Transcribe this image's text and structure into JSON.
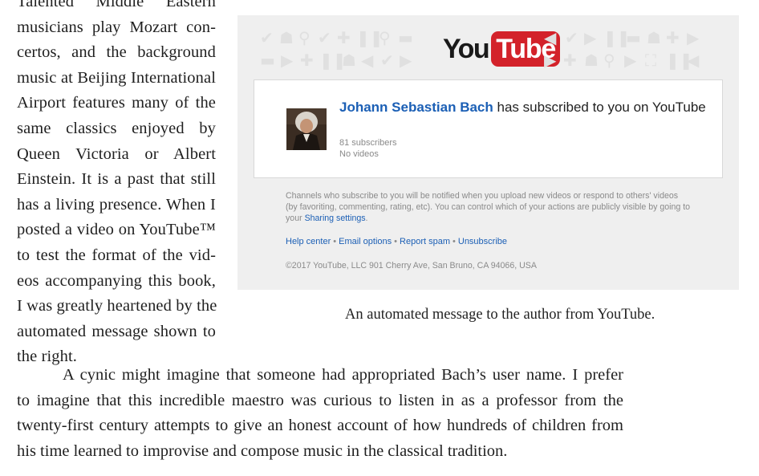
{
  "left_column": {
    "lines": [
      "Talented Middle Eastern",
      "musicians play Mozart con-",
      "certos, and the background",
      "music at Beijing International",
      "Airport features many of the",
      "same classics enjoyed by",
      "Queen Victoria or Albert",
      "Einstein. It is a past that still",
      "has a living presence. When I",
      "posted a video on YouTube™",
      "to test the format of the vid-",
      "eos accompanying this book,",
      "I was greatly heartened by the",
      "automated message shown to",
      "the right."
    ]
  },
  "figure": {
    "logo_you": "You",
    "logo_tube": "Tube",
    "notification": {
      "channel_name": "Johann Sebastian Bach",
      "message": " has subscribed to you on YouTube",
      "subscribers": "81 subscribers",
      "videos": "No videos",
      "avatar_icon": "portrait-icon"
    },
    "footnote_text": "Channels who subscribe to you will be notified when you upload new videos or respond to others' videos (by favoriting, commenting, rating, etc). You can control which of your actions are publicly visible by going to your ",
    "footnote_link": "Sharing settings",
    "footnote_end": ".",
    "links": [
      "Help center",
      "Email options",
      "Report spam",
      "Unsubscribe"
    ],
    "copyright": "©2017 YouTube, LLC 901 Cherry Ave, San Bruno, CA 94066, USA",
    "colors": {
      "link_blue": "#1b5fb5",
      "youtube_red": "#d3222a",
      "background": "#efefef"
    }
  },
  "caption": "An automated message to the author from YouTube.",
  "bottom_paragraph": {
    "lines": [
      "A cynic might imagine that someone had appropriated Bach’s user name. I prefer",
      "to imagine that this incredible maestro was curious to listen in as a professor from the",
      "twenty-first century attempts to give an honest account of how hundreds of children from",
      "his time learned to improvise and compose music in the classical tradition."
    ]
  }
}
